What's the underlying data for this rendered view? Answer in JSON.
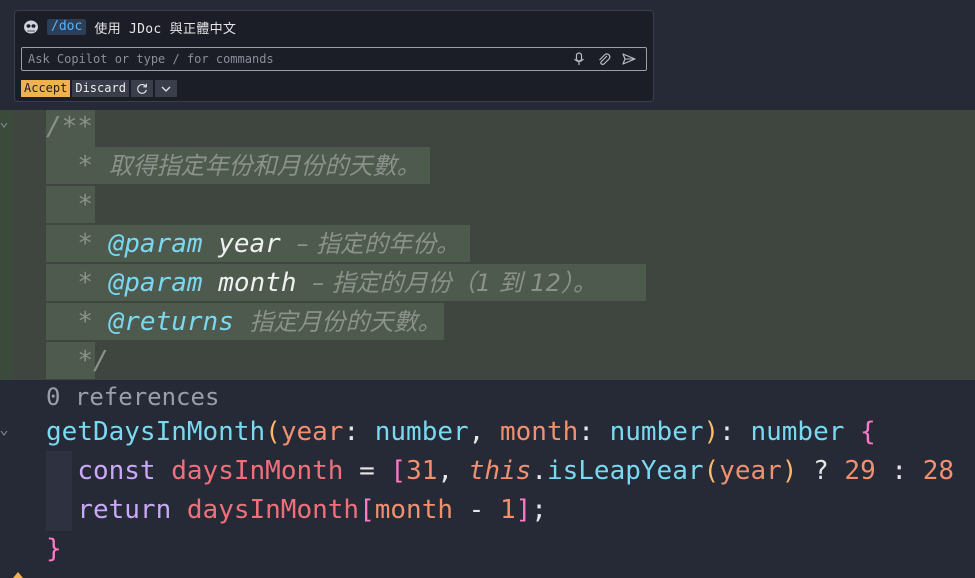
{
  "chat": {
    "icon": "copilot-icon",
    "command": "/doc",
    "prompt": "使用 JDoc 與正體中文",
    "input_placeholder": "Ask Copilot or type / for commands",
    "input_value": "",
    "accept_label": "Accept",
    "discard_label": "Discard",
    "icons": [
      "microphone-icon",
      "attach-icon",
      "send-icon",
      "rerun-icon",
      "chevron-down-icon"
    ]
  },
  "code": {
    "doc_open": "/**",
    "doc_line1_star": "*",
    "doc_line1": "取得指定年份和月份的天數。",
    "doc_line2_star": "*",
    "doc_line3_star": "*",
    "doc_line3_tag": "@param",
    "doc_line3_name": "year",
    "doc_line3_desc": "– 指定的年份。",
    "doc_line4_star": "*",
    "doc_line4_tag": "@param",
    "doc_line4_name": "month",
    "doc_line4_desc": "– 指定的月份（1 到 12）。",
    "doc_line5_star": "*",
    "doc_line5_tag": "@returns",
    "doc_line5_desc": "指定月份的天數。",
    "doc_close": "*/",
    "references": "0 references",
    "sig_name": "getDaysInMonth",
    "sig_open": "(",
    "sig_p1": "year",
    "sig_colon1": ": ",
    "sig_t1": "number",
    "sig_comma": ", ",
    "sig_p2": "month",
    "sig_colon2": ": ",
    "sig_t2": "number",
    "sig_close": ")",
    "sig_colon3": ": ",
    "sig_ret": "number",
    "sig_brace": "{",
    "l2_kw": "const",
    "l2_var": "daysInMonth",
    "l2_eq": " = ",
    "l2_bracket": "[",
    "l2_n1": "31",
    "l2_comma": ", ",
    "l2_this": "this",
    "l2_dot": ".",
    "l2_method": "isLeapYear",
    "l2_po": "(",
    "l2_arg": "year",
    "l2_pc": ")",
    "l2_q": " ? ",
    "l2_n2": "29",
    "l2_colon": " : ",
    "l2_n3": "28",
    "l3_kw": "return",
    "l3_var": "daysInMonth",
    "l3_bo": "[",
    "l3_arg": "month",
    "l3_minus": " - ",
    "l3_num": "1",
    "l3_bc": "]",
    "l3_semi": ";",
    "close_brace": "}"
  }
}
